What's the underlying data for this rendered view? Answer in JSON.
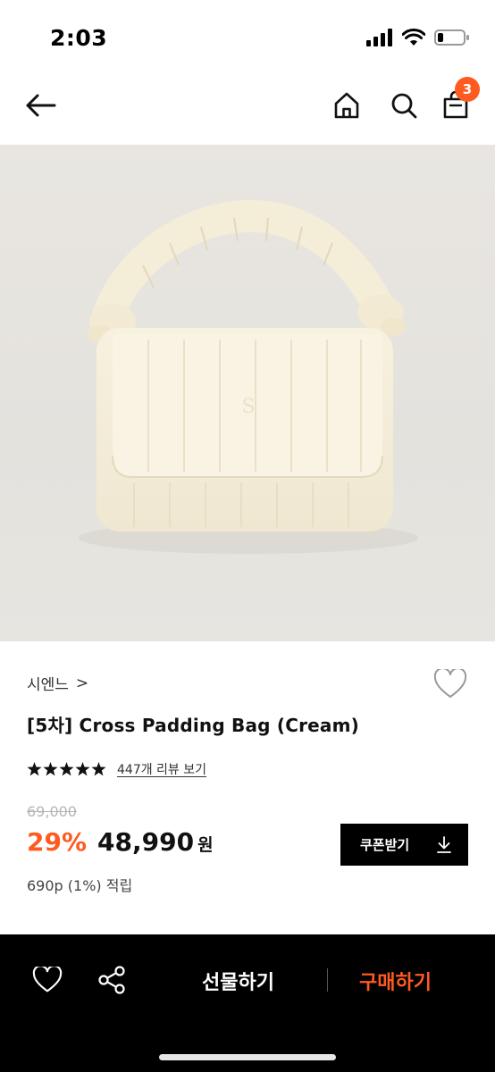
{
  "status_bar": {
    "time": "2:03",
    "battery_level": 0.2
  },
  "nav": {
    "back_icon": "arrow-left-icon",
    "home_icon": "home-icon",
    "search_icon": "search-icon",
    "cart_icon": "shopping-bag-icon",
    "cart_badge": "3"
  },
  "product": {
    "image": "cream-quilted-padding-bag-photo",
    "brand": "시엔느",
    "brand_chevron": ">",
    "title": "[5차] Cross Padding Bag (Cream)",
    "rating_stars": 5,
    "review_link": "447개 리뷰 보기",
    "original_price": "69,000",
    "discount": "29%",
    "sale_price": "48,990",
    "currency": "원",
    "points": "690p (1%) 적립"
  },
  "coupon_button": {
    "label": "쿠폰받기",
    "icon": "download-icon"
  },
  "bottom_bar": {
    "wish_icon": "heart-outline-icon",
    "share_icon": "share-icon",
    "gift_label": "선물하기",
    "buy_label": "구매하기"
  },
  "colors": {
    "accent": "#ff5a1f",
    "bar_bg": "#000000",
    "image_bg": "#e7e5e0"
  }
}
